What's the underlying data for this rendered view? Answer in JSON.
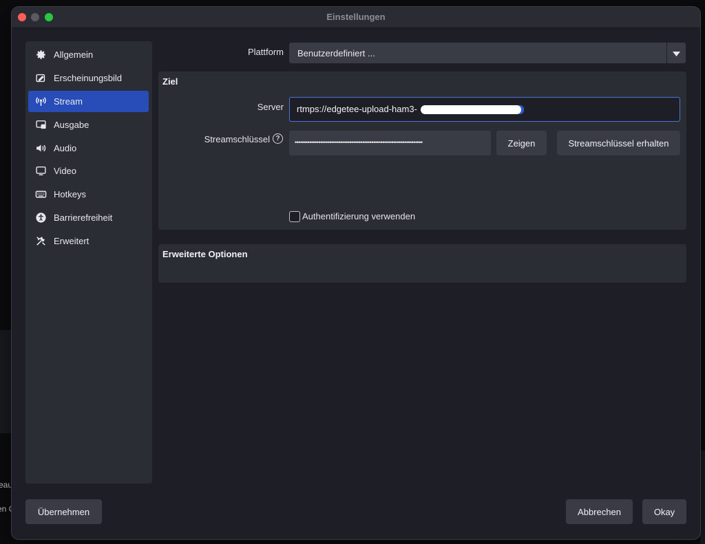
{
  "background": {
    "fragment_1": "eau",
    "fragment_2": "en C"
  },
  "window": {
    "title": "Einstellungen"
  },
  "sidebar": {
    "items": [
      {
        "label": "Allgemein",
        "icon": "gear-icon"
      },
      {
        "label": "Erscheinungsbild",
        "icon": "appearance-icon"
      },
      {
        "label": "Stream",
        "icon": "antenna-icon",
        "active": true
      },
      {
        "label": "Ausgabe",
        "icon": "output-icon"
      },
      {
        "label": "Audio",
        "icon": "speaker-icon"
      },
      {
        "label": "Video",
        "icon": "monitor-icon"
      },
      {
        "label": "Hotkeys",
        "icon": "keyboard-icon"
      },
      {
        "label": "Barrierefreiheit",
        "icon": "accessibility-icon"
      },
      {
        "label": "Erweitert",
        "icon": "tools-icon"
      }
    ]
  },
  "platform": {
    "label": "Plattform",
    "value": "Benutzerdefiniert ..."
  },
  "destination": {
    "title": "Ziel",
    "server_label": "Server",
    "server_value": "rtmps://edgetee-upload-ham3-",
    "key_label": "Streamschlüssel",
    "key_value": "••••••••••••••••••••••••••••••••••••••••••••••••••••••••••••••••••••••",
    "show_button": "Zeigen",
    "get_key_button": "Streamschlüssel erhalten",
    "auth_label": "Authentifizierung verwenden"
  },
  "advanced": {
    "title": "Erweiterte Optionen"
  },
  "footer": {
    "apply_button": "Übernehmen",
    "cancel_button": "Abbrechen",
    "ok_button": "Okay"
  },
  "colors": {
    "accent": "#284cb8",
    "window_bg": "#1e1f26",
    "panel_bg": "#2b2d35"
  }
}
